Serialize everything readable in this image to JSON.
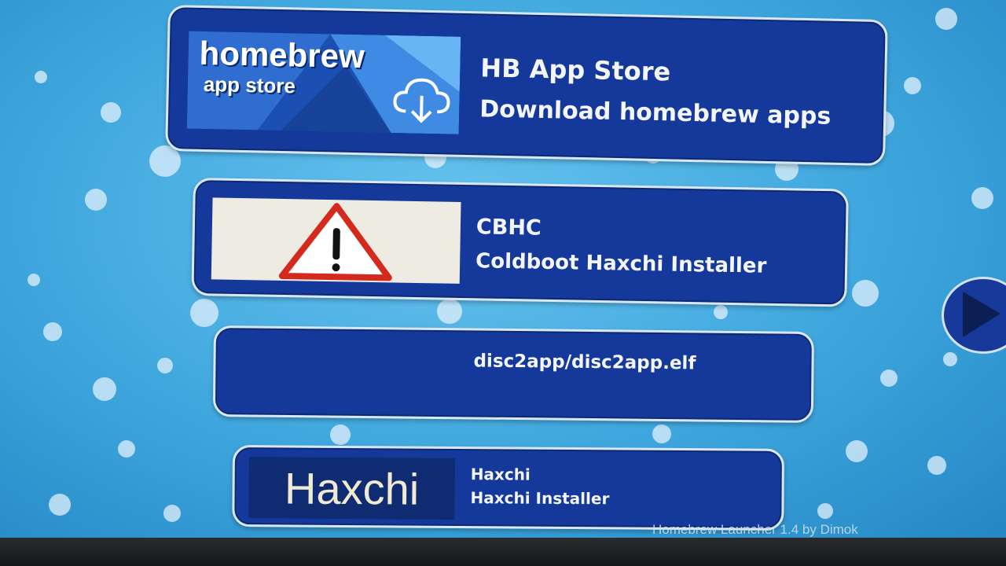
{
  "apps": [
    {
      "title": "HB App Store",
      "subtitle": "Download homebrew apps",
      "icon_name": "homebrew-app-store-icon",
      "icon_text_main": "homebrew",
      "icon_text_sub": "app store"
    },
    {
      "title": "CBHC",
      "subtitle": "Coldboot Haxchi Installer",
      "icon_name": "warning-triangle-icon"
    },
    {
      "title": "disc2app/disc2app.elf"
    },
    {
      "title": "Haxchi",
      "subtitle": "Haxchi Installer",
      "icon_text": "Haxchi"
    }
  ],
  "footer": {
    "text": "Homebrew Launcher 1.4 by Dimok"
  },
  "colors": {
    "background": "#4bb3e6",
    "card": "#14399a",
    "card_border": "#d9e6f3",
    "text": "#f3f5f8",
    "warning_red": "#d42a1e"
  }
}
